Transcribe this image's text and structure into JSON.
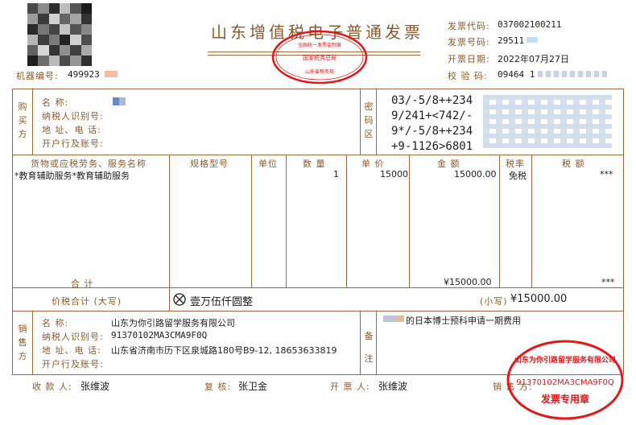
{
  "header": {
    "title": "山东增值税电子普通发票",
    "machine_label": "机器编号:",
    "machine_value": "499923",
    "code_label": "发票代码:",
    "code_value": "037002100211",
    "number_label": "发票号码:",
    "number_value": "29511",
    "date_label": "开票日期:",
    "date_value": "2022年07月27日",
    "check_label": "校 验 码:",
    "check_value": "09464 1"
  },
  "buyer": {
    "section": [
      "购",
      "买",
      "方"
    ],
    "name_label": "名        称:",
    "tax_label": "纳税人识别号:",
    "addr_label": "地 址、电 话:",
    "bank_label": "开户行及账号:",
    "pwd_section": [
      "密",
      "码",
      "区"
    ],
    "pwd_lines": [
      "03/-5/8++234",
      "9/241+<742/-",
      "9*/-5/8++234",
      "+9-1126>6801"
    ]
  },
  "items": {
    "headers": {
      "name": "货物或应税劳务、服务名称",
      "spec": "规格型号",
      "unit": "单位",
      "qty": "数  量",
      "price": "单  价",
      "amount": "金  额",
      "rate": "税率",
      "tax": "税  额"
    },
    "rows": [
      {
        "name": "*教育辅助服务*教育辅助服务",
        "qty": "1",
        "price": "15000",
        "amount": "15000.00",
        "rate": "免税",
        "tax": "***"
      }
    ],
    "total_label": "合      计",
    "total_amount": "¥15000.00",
    "total_tax": "***"
  },
  "grand_total": {
    "label": "价税合计 (大写)",
    "capital": "壹万伍仟圆整",
    "small_label": "(小写)",
    "small_value": "¥15000.00"
  },
  "seller": {
    "section": [
      "销",
      "售",
      "方"
    ],
    "name_label": "名        称:",
    "name_value": "山东为你引路留学服务有限公司",
    "tax_label": "纳税人识别号:",
    "tax_value": "91370102MA3CMA9F0Q",
    "addr_label": "地 址、电 话:",
    "addr_value": "山东省济南市历下区泉城路180号B9-12, 18653633819",
    "bank_label": "开户行及账号:",
    "remark_section": [
      "备",
      "注"
    ],
    "remark_value": "的日本博士预科申请一期费用"
  },
  "footer": {
    "payee_label": "收 款 人:",
    "payee_value": "张维波",
    "reviewer_label": "复 核:",
    "reviewer_value": "张卫金",
    "drawer_label": "开 票 人:",
    "drawer_value": "张维波",
    "seller_label": "销 售 方:"
  },
  "stamps": {
    "tax_seal_text": "全国统一发票监制章 国家税务总局 山东省税务局",
    "seller_seal_text": "山东为你引路留学服务有限公司 91370102MA3CMA9F0Q 发票专用章"
  },
  "colors": {
    "frame": "#9a6a3c",
    "label": "#8b5a2b",
    "seal": "#e01818"
  }
}
